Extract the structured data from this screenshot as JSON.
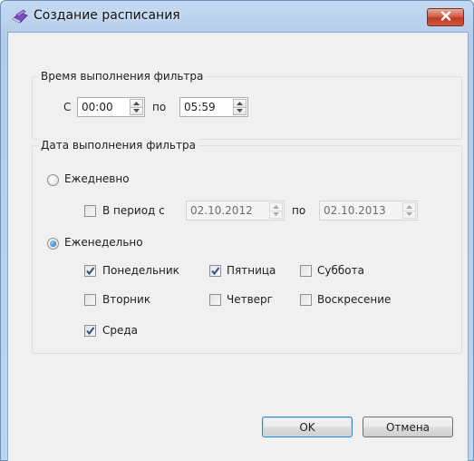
{
  "window": {
    "title": "Создание расписания"
  },
  "time_group": {
    "legend": "Время выполнения фильтра",
    "from_label": "С",
    "from_value": "00:00",
    "to_label": "по",
    "to_value": "05:59"
  },
  "date_group": {
    "legend": "Дата выполнения фильтра",
    "daily": {
      "label": "Ежедневно",
      "selected": false
    },
    "period": {
      "label": "В период с",
      "checked": false,
      "from_value": "02.10.2012",
      "to_label": "по",
      "to_value": "02.10.2013"
    },
    "weekly": {
      "label": "Еженедельно",
      "selected": true
    },
    "days": {
      "monday": {
        "label": "Понедельник",
        "checked": true
      },
      "friday": {
        "label": "Пятница",
        "checked": true
      },
      "saturday": {
        "label": "Суббота",
        "checked": false
      },
      "tuesday": {
        "label": "Вторник",
        "checked": false
      },
      "thursday": {
        "label": "Четверг",
        "checked": false
      },
      "sunday": {
        "label": "Воскресение",
        "checked": false
      },
      "wednesday": {
        "label": "Среда",
        "checked": true
      }
    }
  },
  "buttons": {
    "ok": "OK",
    "cancel": "Отмена"
  },
  "icons": {
    "title": "schedule-book-icon",
    "close": "close-icon"
  },
  "colors": {
    "close_button": "#c8432a",
    "check_mark": "#2a4e8a",
    "radio_dot": "#1b5fb5"
  }
}
